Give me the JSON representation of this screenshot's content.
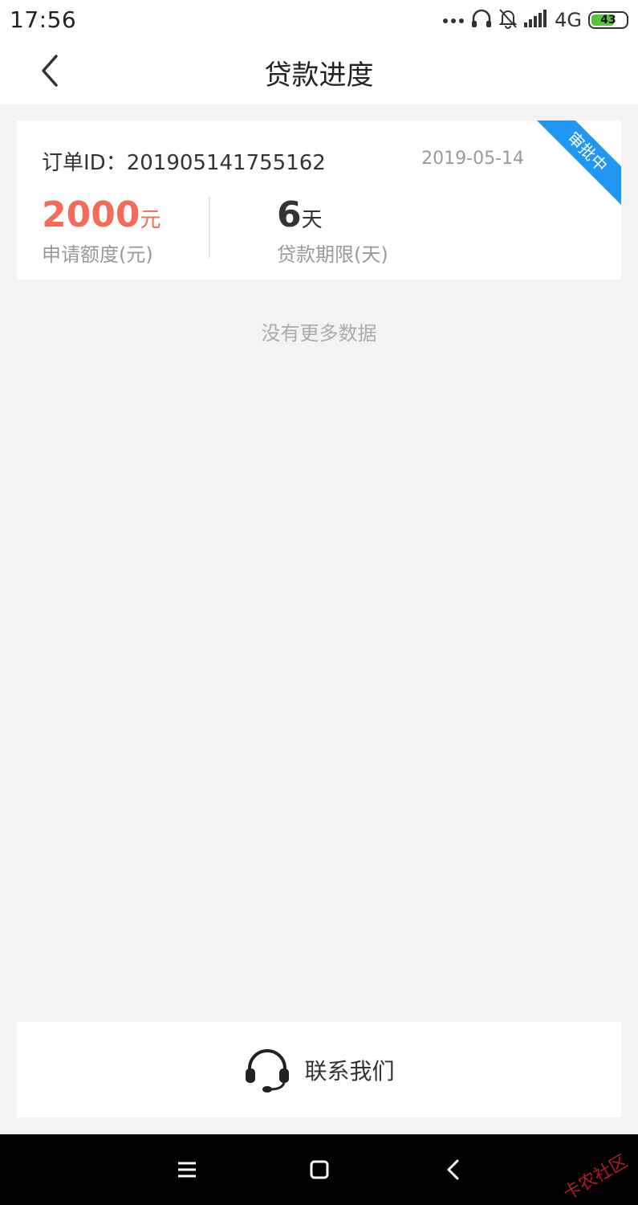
{
  "status_bar": {
    "time": "17:56",
    "network": "4G",
    "battery": "43",
    "battery_color": "#59c43a"
  },
  "nav": {
    "title": "贷款进度"
  },
  "order_card": {
    "order_id_label": "订单ID：201905141755162",
    "date": "2019-05-14",
    "badge": "审批中",
    "badge_color": "#2196f3",
    "amount": "2000",
    "amount_unit": "元",
    "amount_label": "申请额度(元)",
    "amount_color": "#f26b5b",
    "term": "6",
    "term_unit": "天",
    "term_label": "贷款期限(天)"
  },
  "list_end_text": "没有更多数据",
  "contact": {
    "label": "联系我们",
    "icon": "headset-icon"
  },
  "watermark": "卡农社区",
  "system_nav": {
    "icons": [
      "menu-icon",
      "home-icon",
      "back-icon"
    ]
  }
}
